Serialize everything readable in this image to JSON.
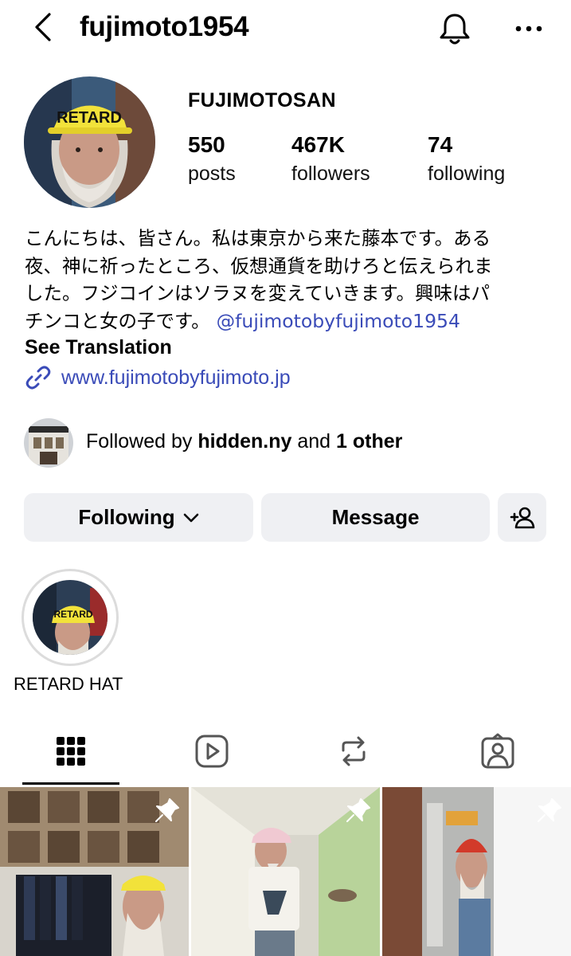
{
  "header": {
    "username": "fujimoto1954",
    "back_icon": "chevron-left-icon",
    "bell_icon": "bell-icon",
    "more_icon": "more-horizontal-icon"
  },
  "profile": {
    "display_name": "FUJIMOTOSAN",
    "stats": [
      {
        "value": "550",
        "label": "posts"
      },
      {
        "value": "467K",
        "label": "followers"
      },
      {
        "value": "74",
        "label": "following"
      }
    ],
    "avatar_hat_text": "RETARD",
    "bio_lines": [
      "こんにちは、皆さん。私は東京から来た藤本です。ある",
      "夜、神に祈ったところ、仮想通貨を助けろと伝えられま",
      "した。フジコインはソラヌを変えていきます。興味はパ",
      "チンコと女の子です。"
    ],
    "bio_mention": "@fujimotobyfujimoto1954",
    "see_translation": "See Translation",
    "link": "www.fujimotobyfujimoto.jp",
    "followed_by": {
      "prefix": "Followed by",
      "user": "hidden.ny",
      "middle": "and",
      "others": "1 other"
    }
  },
  "actions": {
    "following_label": "Following",
    "message_label": "Message",
    "add_icon": "add-person-icon"
  },
  "highlights": [
    {
      "label": "RETARD HAT",
      "hat_text": "RETARD"
    }
  ],
  "tabs": [
    {
      "icon": "grid-icon",
      "active": true
    },
    {
      "icon": "reels-icon",
      "active": false
    },
    {
      "icon": "repost-icon",
      "active": false
    },
    {
      "icon": "tagged-icon",
      "active": false
    }
  ],
  "colors": {
    "link": "#3a4bb8",
    "button_bg": "#eff0f3",
    "hat_yellow": "#f2e23a"
  }
}
